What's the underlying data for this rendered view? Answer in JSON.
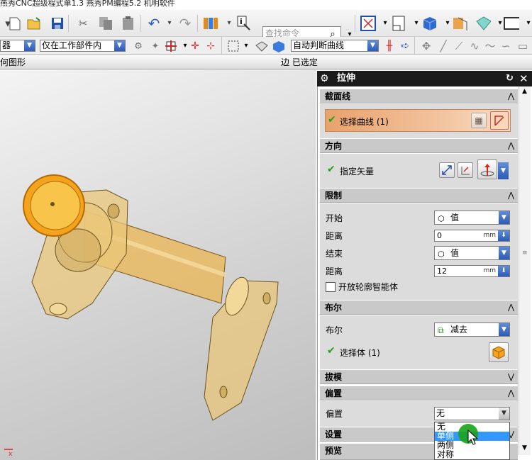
{
  "window": {
    "title": "燕秀CNC超级程式单1.3   燕秀PM编程5.2   机明软件"
  },
  "toolbar": {
    "search_placeholder": "查找命令",
    "filter_left_value": "器",
    "scope_value": "仅在工作部件内",
    "curve_rule_value": "自动判断曲线"
  },
  "statusbar": {
    "left_text": "何图形",
    "right_text": "边 已选定"
  },
  "dialog": {
    "title": "拉伸",
    "sections": {
      "section_curve": {
        "header": "截面线",
        "select_label": "选择曲线 (1)"
      },
      "direction": {
        "header": "方向",
        "vector_label": "指定矢量"
      },
      "limits": {
        "header": "限制",
        "start_label": "开始",
        "start_value": "值",
        "start_distance_label": "距离",
        "start_distance": "0",
        "end_label": "结束",
        "end_value": "值",
        "end_distance_label": "距离",
        "end_distance": "12",
        "unit": "mm",
        "open_profile_label": "开放轮廓智能体"
      },
      "boolean": {
        "header": "布尔",
        "boolean_label": "布尔",
        "boolean_value": "减去",
        "select_body_label": "选择体 (1)"
      },
      "draft": {
        "header": "拔模"
      },
      "offset": {
        "header": "偏置",
        "offset_label": "偏置",
        "offset_value": "无",
        "options": [
          "无",
          "单侧",
          "两侧",
          "对称"
        ],
        "highlighted_option": "单侧"
      },
      "settings": {
        "header": "设置"
      },
      "preview": {
        "header": "预览"
      }
    }
  },
  "colors": {
    "dialog_title_bg": "#1b1b1b",
    "section_header_bg": "#c9c9c9",
    "selection_highlight": "#e8a26c",
    "part_color": "#e9c77a",
    "check_green": "#1fa21f",
    "dropdown_blue": "#2d5ab8"
  }
}
